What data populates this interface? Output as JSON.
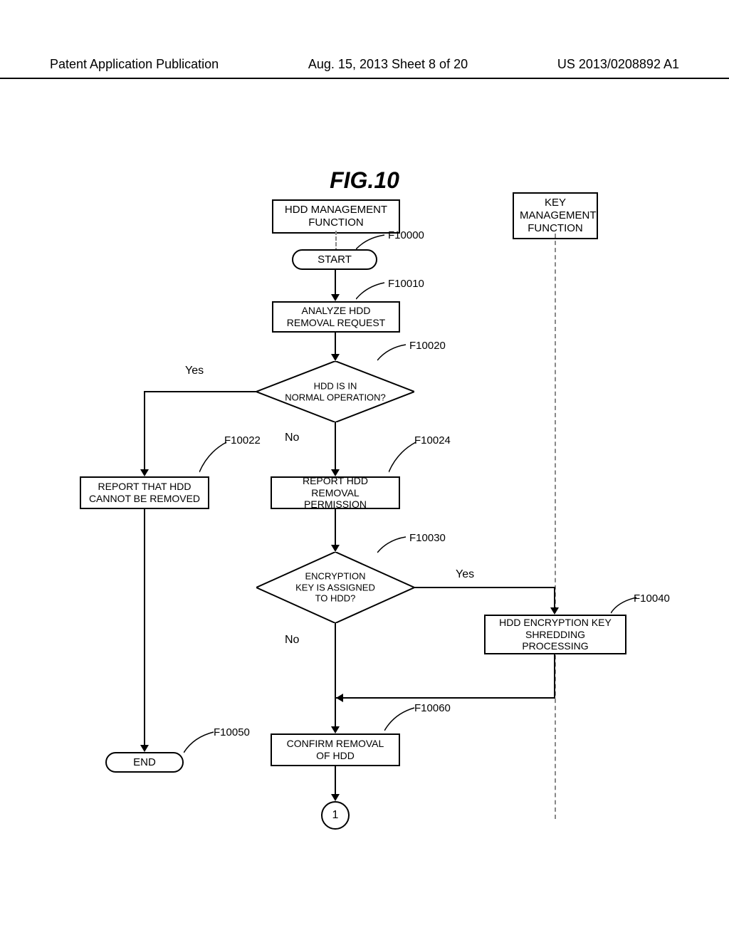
{
  "header": {
    "left": "Patent Application Publication",
    "center": "Aug. 15, 2013  Sheet 8 of 20",
    "right": "US 2013/0208892 A1"
  },
  "figure_title": "FIG.10",
  "lanes": {
    "hdd_mgmt": "HDD MANAGEMENT\nFUNCTION",
    "key_mgmt": "KEY\nMANAGEMENT\nFUNCTION"
  },
  "nodes": {
    "start": "START",
    "analyze": "ANALYZE HDD\nREMOVAL REQUEST",
    "decision1": "HDD IS IN\nNORMAL OPERATION?",
    "cannot_remove": "REPORT THAT HDD\nCANNOT BE REMOVED",
    "permission": "REPORT HDD\nREMOVAL PERMISSION",
    "decision2": "ENCRYPTION\nKEY IS ASSIGNED\nTO HDD?",
    "shred": "HDD ENCRYPTION KEY\nSHREDDING\nPROCESSING",
    "confirm": "CONFIRM REMOVAL\nOF HDD",
    "end": "END",
    "connector": "1"
  },
  "refs": {
    "f10000": "F10000",
    "f10010": "F10010",
    "f10020": "F10020",
    "f10022": "F10022",
    "f10024": "F10024",
    "f10030": "F10030",
    "f10040": "F10040",
    "f10050": "F10050",
    "f10060": "F10060"
  },
  "answers": {
    "yes": "Yes",
    "no": "No"
  }
}
